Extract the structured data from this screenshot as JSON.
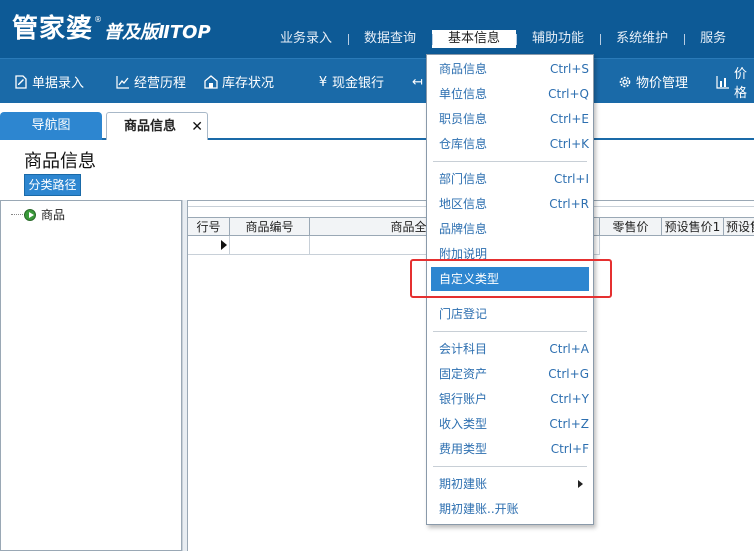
{
  "app": {
    "logo_main": "管家婆",
    "logo_reg": "®",
    "logo_sub": "普及版ⅡTOP"
  },
  "top_menu": [
    "业务录入",
    "数据查询",
    "基本信息",
    "辅助功能",
    "系统维护",
    "服务"
  ],
  "toolbar": {
    "items": [
      {
        "label": "单据录入",
        "icon": "document-edit-icon"
      },
      {
        "label": "经营历程",
        "icon": "line-chart-icon"
      },
      {
        "label": "库存状况",
        "icon": "warehouse-icon"
      },
      {
        "label": "现金银行",
        "icon": "yen-icon"
      },
      {
        "label": "",
        "icon": "arrow-icon"
      },
      {
        "label": "物价管理",
        "icon": "gear-icon"
      },
      {
        "label": "价格",
        "icon": "bar-chart-icon"
      }
    ]
  },
  "tabs": {
    "nav": "导航图",
    "goods": "商品信息",
    "close": "✕"
  },
  "page": {
    "title": "商品信息",
    "category_button": "分类路径"
  },
  "tree": {
    "root": "商品"
  },
  "grid": {
    "columns": [
      "行号",
      "商品编号",
      "商品全名",
      "",
      "零售价",
      "预设售价1",
      "预设售"
    ]
  },
  "dropdown": {
    "items": [
      {
        "label": "商品信息",
        "shortcut": "Ctrl+S"
      },
      {
        "label": "单位信息",
        "shortcut": "Ctrl+Q"
      },
      {
        "label": "职员信息",
        "shortcut": "Ctrl+E"
      },
      {
        "label": "仓库信息",
        "shortcut": "Ctrl+K"
      },
      {
        "label": "部门信息",
        "shortcut": "Ctrl+I"
      },
      {
        "label": "地区信息",
        "shortcut": "Ctrl+R"
      },
      {
        "label": "品牌信息",
        "shortcut": ""
      },
      {
        "label": "附加说明",
        "shortcut": ""
      },
      {
        "label": "自定义类型",
        "shortcut": ""
      },
      {
        "label": "门店登记",
        "shortcut": ""
      },
      {
        "label": "会计科目",
        "shortcut": "Ctrl+A"
      },
      {
        "label": "固定资产",
        "shortcut": "Ctrl+G"
      },
      {
        "label": "银行账户",
        "shortcut": "Ctrl+Y"
      },
      {
        "label": "收入类型",
        "shortcut": "Ctrl+Z"
      },
      {
        "label": "费用类型",
        "shortcut": "Ctrl+F"
      },
      {
        "label": "期初建账",
        "shortcut": ""
      },
      {
        "label": "期初建账..开账",
        "shortcut": ""
      }
    ]
  },
  "colors": {
    "header_bg": "#0d5a96",
    "toolbar_bg": "#1a6aa8",
    "accent": "#2d86d0",
    "menu_text": "#2d6fb0",
    "highlight_box": "#e53030"
  }
}
